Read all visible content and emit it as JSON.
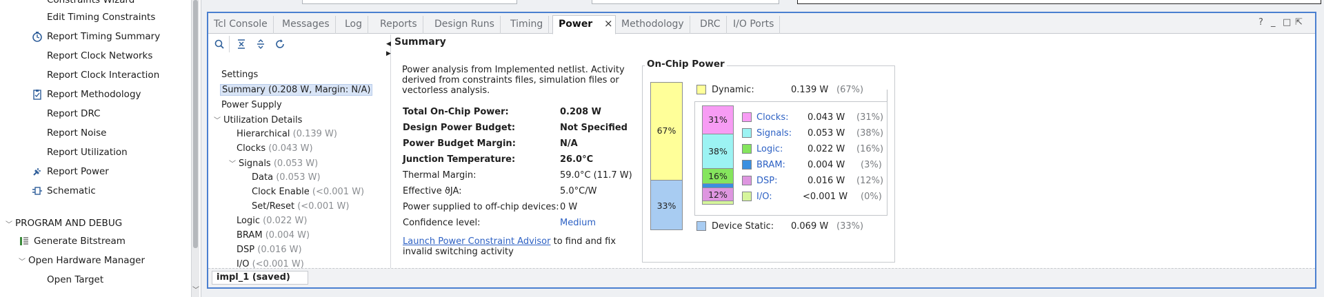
{
  "flow_nav": {
    "items": [
      {
        "label": "Constraints Wizard",
        "icon": "none"
      },
      {
        "label": "Edit Timing Constraints",
        "icon": "none"
      },
      {
        "label": "Report Timing Summary",
        "icon": "clock-icon"
      },
      {
        "label": "Report Clock Networks",
        "icon": "none"
      },
      {
        "label": "Report Clock Interaction",
        "icon": "none"
      },
      {
        "label": "Report Methodology",
        "icon": "clipboard-icon"
      },
      {
        "label": "Report DRC",
        "icon": "none"
      },
      {
        "label": "Report Noise",
        "icon": "none"
      },
      {
        "label": "Report Utilization",
        "icon": "none"
      },
      {
        "label": "Report Power",
        "icon": "power-plug-icon"
      },
      {
        "label": "Schematic",
        "icon": "schematic-icon"
      }
    ],
    "section": "PROGRAM AND DEBUG",
    "section_items": [
      {
        "label": "Generate Bitstream",
        "icon": "bitstream-icon"
      },
      {
        "label": "Open Hardware Manager",
        "icon": "none"
      },
      {
        "label": "Open Target",
        "icon": "none"
      }
    ]
  },
  "tabs": [
    "Tcl Console",
    "Messages",
    "Log",
    "Reports",
    "Design Runs",
    "Timing",
    "Power",
    "Methodology",
    "DRC",
    "I/O Ports"
  ],
  "active_tab": "Power",
  "window_controls": [
    "?",
    "_",
    "□",
    "⇱"
  ],
  "tree": {
    "settings": "Settings",
    "summary": "Summary (0.208 W, Margin: N/A)",
    "power_supply": "Power Supply",
    "utilization": "Utilization Details",
    "hierarchical": {
      "label": "Hierarchical",
      "value": "(0.139 W)"
    },
    "clocks": {
      "label": "Clocks",
      "value": "(0.043 W)"
    },
    "signals": {
      "label": "Signals",
      "value": "(0.053 W)"
    },
    "data": {
      "label": "Data",
      "value": "(0.053 W)"
    },
    "clock_enable": {
      "label": "Clock Enable",
      "value": "(<0.001 W)"
    },
    "set_reset": {
      "label": "Set/Reset",
      "value": "(<0.001 W)"
    },
    "logic": {
      "label": "Logic",
      "value": "(0.022 W)"
    },
    "bram": {
      "label": "BRAM",
      "value": "(0.004 W)"
    },
    "dsp": {
      "label": "DSP",
      "value": "(0.016 W)"
    },
    "io": {
      "label": "I/O",
      "value": "(<0.001 W)"
    }
  },
  "summary": {
    "header": "Summary",
    "intro_line1": "Power analysis from Implemented netlist. Activity",
    "intro_line2": "derived from constraints files, simulation files or",
    "intro_line3": "vectorless analysis.",
    "rows": [
      {
        "label": "Total On-Chip Power:",
        "value": "0.208 W",
        "bold": true
      },
      {
        "label": "Design Power Budget:",
        "value": "Not Specified",
        "bold": true
      },
      {
        "label": "Power Budget Margin:",
        "value": "N/A",
        "bold": true
      },
      {
        "label": "Junction Temperature:",
        "value": "26.0°C",
        "bold": true
      },
      {
        "label": "Thermal Margin:",
        "value": "59.0°C (11.7 W)",
        "bold": false
      },
      {
        "label": "Effective ϑJA:",
        "value": "5.0°C/W",
        "bold": false
      },
      {
        "label": "Power supplied to off-chip devices:",
        "value": "0 W",
        "bold": false
      },
      {
        "label": "Confidence level:",
        "value": "Medium",
        "bold": false
      }
    ],
    "advisor_link": "Launch Power Constraint Advisor",
    "advisor_rest1": " to find and fix",
    "advisor_rest2": "invalid switching activity"
  },
  "onchip": {
    "title": "On-Chip Power",
    "dynamic": {
      "label": "Dynamic:",
      "value": "0.139 W",
      "pct": "(67%)",
      "bar_label": "67%",
      "color": "#ffff99"
    },
    "static": {
      "label": "Device Static:",
      "value": "0.069 W",
      "pct": "(33%)",
      "bar_label": "33%",
      "color": "#a8ccf2"
    },
    "breakdown": [
      {
        "label": "Clocks:",
        "value": "0.043 W",
        "pct": "(31%)",
        "bar_label": "31%",
        "color": "#f79cf4"
      },
      {
        "label": "Signals:",
        "value": "0.053 W",
        "pct": "(38%)",
        "bar_label": "38%",
        "color": "#9cf3f3"
      },
      {
        "label": "Logic:",
        "value": "0.022 W",
        "pct": "(16%)",
        "bar_label": "16%",
        "color": "#85e55d"
      },
      {
        "label": "BRAM:",
        "value": "0.004 W",
        "pct": "(3%)",
        "bar_label": "",
        "color": "#3a8fe0"
      },
      {
        "label": "DSP:",
        "value": "0.016 W",
        "pct": "(12%)",
        "bar_label": "12%",
        "color": "#de96e0"
      },
      {
        "label": "I/O:",
        "value": "<0.001 W",
        "pct": "(0%)",
        "bar_label": "",
        "color": "#d6f59c"
      }
    ]
  },
  "run_tab": "impl_1 (saved)"
}
